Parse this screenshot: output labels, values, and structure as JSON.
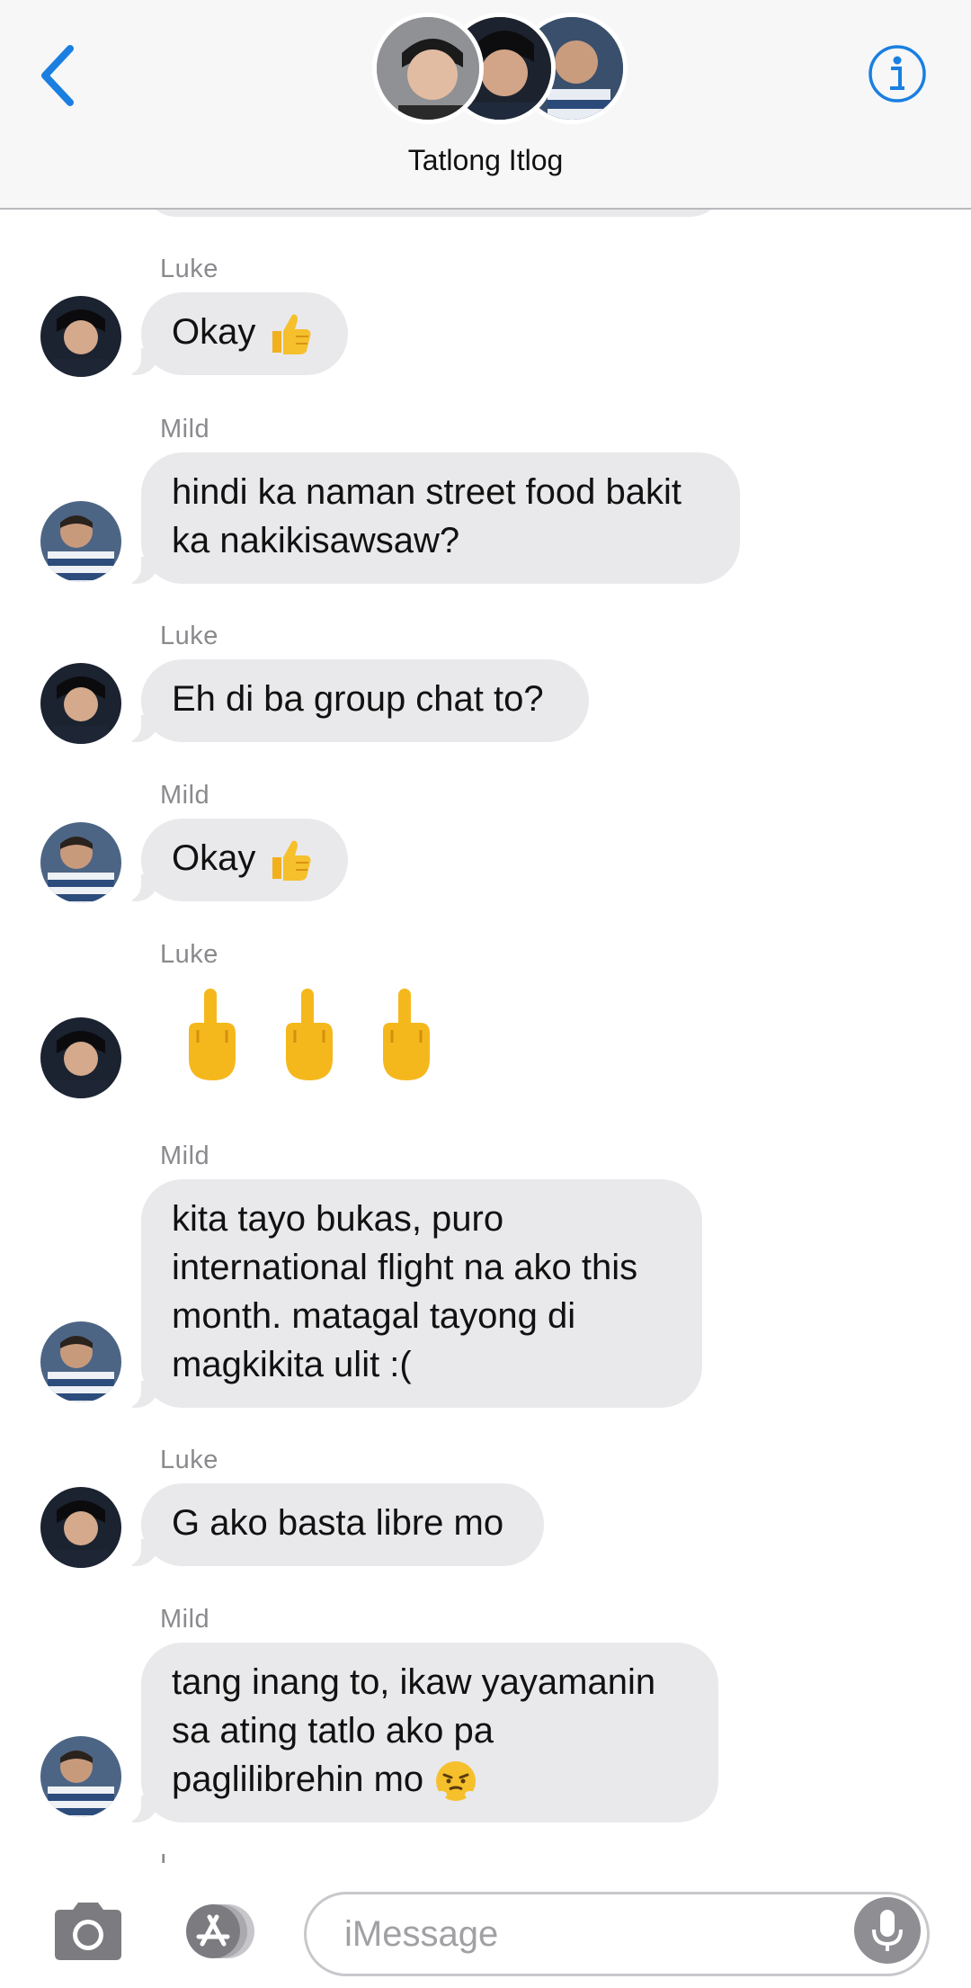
{
  "header": {
    "title": "Tatlong Itlog",
    "back_icon": "chevron-left-icon",
    "info_icon": "info-icon"
  },
  "colors": {
    "accent": "#1a7fe0",
    "bubble_gray": "#e9e9eb",
    "sender_gray": "#8a8a8e",
    "emoji_yellow": "#f5b81c"
  },
  "messages": [
    {
      "sender": "Luke",
      "text": "Okay",
      "emoji": "thumbs-up"
    },
    {
      "sender": "Mild",
      "lines": [
        "hindi ka naman street food bakit",
        "ka nakikisawsaw?"
      ]
    },
    {
      "sender": "Luke",
      "text": "Eh di ba group chat to?"
    },
    {
      "sender": "Mild",
      "text": "Okay",
      "emoji": "thumbs-up"
    },
    {
      "sender": "Luke",
      "emoji_only": [
        "middle-finger",
        "middle-finger",
        "middle-finger"
      ]
    },
    {
      "sender": "Mild",
      "lines": [
        "kita tayo bukas, puro",
        "international flight na ako this",
        "month. matagal tayong di",
        "magkikita ulit :("
      ]
    },
    {
      "sender": "Luke",
      "text": "G ako basta libre mo"
    },
    {
      "sender": "Mild",
      "lines": [
        "tang inang to, ikaw yayamanin",
        "sa ating tatlo ako pa",
        "paglilibrehin mo"
      ],
      "emoji": "huffing-face"
    }
  ],
  "input": {
    "placeholder": "iMessage",
    "camera_icon": "camera-icon",
    "apps_icon": "app-store-icon",
    "mic_icon": "microphone-icon"
  }
}
